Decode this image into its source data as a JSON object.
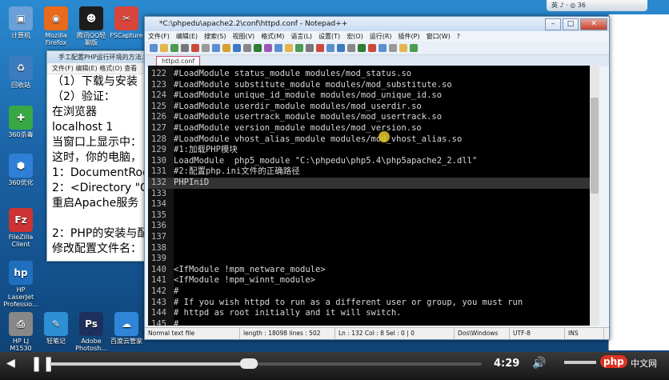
{
  "desktop_icons": [
    {
      "label": "计算机",
      "color": "#6aa0d8",
      "glyph": "▣"
    },
    {
      "label": "Mozilla Firefox",
      "color": "#e96a1b",
      "glyph": "◉"
    },
    {
      "label": "腾讯QQ轻聊版",
      "color": "#1d1d1d",
      "glyph": "☻"
    },
    {
      "label": "FSCapture",
      "color": "#d8453a",
      "glyph": "✂"
    },
    {
      "label": "回收站",
      "color": "#3b7bc0",
      "glyph": "♻"
    },
    {
      "label": "360杀毒",
      "color": "#38a845",
      "glyph": "✚"
    },
    {
      "label": "360优化",
      "color": "#2f7fd6",
      "glyph": "⬢"
    },
    {
      "label": "FileZilla Client",
      "color": "#c33",
      "glyph": "Fz"
    },
    {
      "label": "HP LaserJet Professio...",
      "color": "#1f6fbf",
      "glyph": "hp"
    },
    {
      "label": "HP LJ M1530 Scan",
      "color": "#888",
      "glyph": "⎙"
    },
    {
      "label": "轻笔记",
      "color": "#2e8fd5",
      "glyph": "✎"
    },
    {
      "label": "Adobe Photosh...",
      "color": "#1d2f5e",
      "glyph": "Ps"
    },
    {
      "label": "百度云管家",
      "color": "#2f86d8",
      "glyph": "☁"
    }
  ],
  "back_window": {
    "title": "手工配置PHP运行环境的方法.txt",
    "menu": "文件(F)  编辑(E)  格式(O)  查看",
    "lines": [
      "（1）下载与安装",
      "（2）验证：",
      "在浏览器",
      "localhost   1",
      "当窗口上显示中：",
      "这时，你的电脑，",
      "1：DocumentRoo",
      "2：<Directory \"C",
      "重启Apache服务",
      "",
      "2：PHP的安装与配",
      "修改配置文件名："
    ]
  },
  "npp": {
    "title": "*C:\\phpedu\\apache2.2\\conf\\httpd.conf - Notepad++",
    "menu": [
      "文件(F)",
      "编辑(E)",
      "搜索(S)",
      "视图(V)",
      "格式(M)",
      "语言(L)",
      "设置(T)",
      "宏(O)",
      "运行(R)",
      "插件(P)",
      "窗口(W)",
      "?"
    ],
    "tab": "httpd.conf",
    "lines": [
      {
        "no": "122",
        "text": "#LoadModule status_module modules/mod_status.so"
      },
      {
        "no": "123",
        "text": "#LoadModule substitute_module modules/mod_substitute.so"
      },
      {
        "no": "124",
        "text": "#LoadModule unique_id_module modules/mod_unique_id.so"
      },
      {
        "no": "125",
        "text": "#LoadModule userdir_module modules/mod_userdir.so"
      },
      {
        "no": "126",
        "text": "#LoadModule usertrack_module modules/mod_usertrack.so"
      },
      {
        "no": "127",
        "text": "#LoadModule version_module modules/mod_version.so"
      },
      {
        "no": "128",
        "text": "#LoadModule vhost_alias_module modules/mod_vhost_alias.so"
      },
      {
        "no": "129",
        "text": "#1:加载PHP模块"
      },
      {
        "no": "130",
        "text": "LoadModule  php5_module \"C:\\phpedu\\php5.4\\php5apache2_2.dll\""
      },
      {
        "no": "131",
        "text": "#2:配置php.ini文件的正确路径"
      },
      {
        "no": "132",
        "text": "PHPIniD",
        "current": true
      },
      {
        "no": "133",
        "text": ""
      },
      {
        "no": "134",
        "text": ""
      },
      {
        "no": "135",
        "text": ""
      },
      {
        "no": "136",
        "text": ""
      },
      {
        "no": "137",
        "text": ""
      },
      {
        "no": "138",
        "text": ""
      },
      {
        "no": "139",
        "text": ""
      },
      {
        "no": "140",
        "text": "<IfModule !mpm_netware_module>"
      },
      {
        "no": "141",
        "text": "<IfModule !mpm_winnt_module>"
      },
      {
        "no": "142",
        "text": "#"
      },
      {
        "no": "143",
        "text": "# If you wish httpd to run as a different user or group, you must run"
      },
      {
        "no": "144",
        "text": "# httpd as root initially and it will switch."
      },
      {
        "no": "145",
        "text": "#"
      }
    ],
    "status": [
      "Normal text file",
      "length : 18098   lines : 502",
      "Ln : 132   Col : 8   Sel : 0 | 0",
      "Dos\\Windows",
      "UTF-8",
      "INS"
    ]
  },
  "ime": "英 ♪ ·  ◎  36",
  "player": {
    "time": "4:29"
  }
}
